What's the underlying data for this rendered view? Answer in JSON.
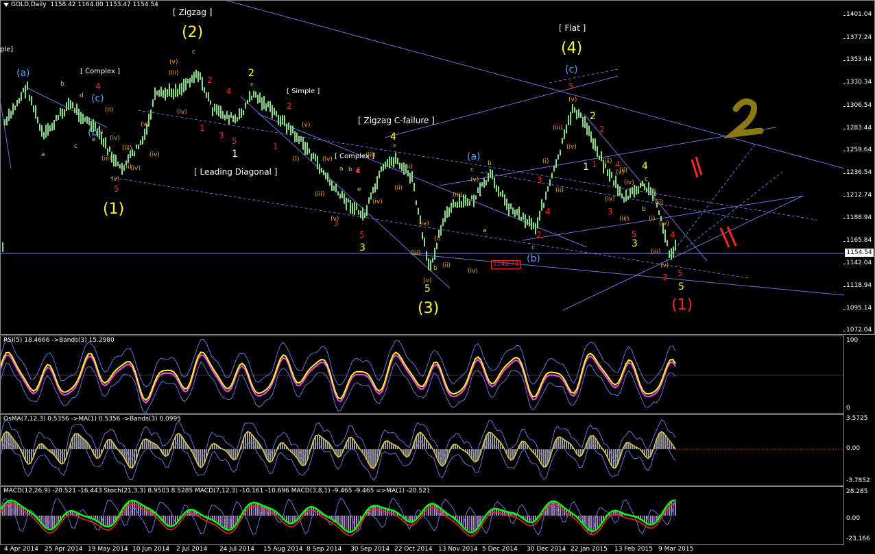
{
  "main_chart": {
    "symbol_label": "GOLD,Daily",
    "ohlc": "1158.42 1164.00 1153.47 1154.54",
    "current_price": "1154.54",
    "low_annotation": "1142.74",
    "price_axis": [
      "1401.04",
      "1377.24",
      "1353.44",
      "1330.34",
      "1306.54",
      "1283.44",
      "1259.64",
      "1236.54",
      "1212.74",
      "1188.94",
      "1165.84",
      "1142.04",
      "1118.94",
      "1095.14",
      "1072.04"
    ],
    "labels": {
      "zigzag": "[ Zigzag ]",
      "flat": "[ Flat ]",
      "complex1": "[ Complex ]",
      "complex2": "[ Complex ]",
      "simple": "[ Simple ]",
      "zigzag_cfail": "[ Zigzag C-failure ]",
      "leading_diag": "[ Leading Diagonal ]",
      "ple": "ple]",
      "w1": "(1)",
      "w2": "(2)",
      "w3": "(3)",
      "w4": "(4)",
      "w1b": "(1)",
      "a": "(a)",
      "b": "(b)",
      "c": "(c)",
      "n1": "1",
      "n2": "2",
      "n3": "3",
      "n4": "4",
      "n5": "5",
      "r_i": "(i)",
      "r_ii": "(ii)",
      "r_iii": "(iii)",
      "r_iv": "(iv)",
      "r_v": "(v)",
      "la": "a",
      "lb": "b",
      "lc": "c",
      "ld": "d",
      "le": "e"
    }
  },
  "rsi": {
    "title": "RSI(5) 18.4666  ->Bands(3) 15.2980",
    "axis": [
      "100",
      "0"
    ]
  },
  "osma": {
    "title": "OsMA(7,12,3) 0.5356  ->MA(1) 0.5356  ->Bands(3) 0.0995",
    "axis": [
      "3.5725",
      "0.00",
      "-3.7852"
    ]
  },
  "macd": {
    "title": "MACD(12,26,9) -20.521 -16.443  Stoch(21,3,3) 8.9503 8.5285  MACD(7,12,3) -10.161 -10.696  MACD(3,8,1) -9.465 -9.465  =>MA(1) -20.521",
    "axis": [
      "28.285",
      "0.00",
      "-23.166"
    ]
  },
  "dates": [
    "4 Apr 2014",
    "25 Apr 2014",
    "19 May 2014",
    "10 Jun 2014",
    "2 Jul 2014",
    "24 Jul 2014",
    "15 Aug 2014",
    "8 Sep 2014",
    "30 Sep 2014",
    "22 Oct 2014",
    "13 Nov 2014",
    "5 Dec 2014",
    "30 Dec 2014",
    "22 Jan 2015",
    "13 Feb 2015",
    "9 Mar 2015"
  ],
  "colors": {
    "candle": "#7ee37e",
    "trendline": "#6a70e0",
    "rsi_line": "#ffff00",
    "rsi_ma": "#ff44ff",
    "green": "#00ff00",
    "red": "#ff2020"
  }
}
